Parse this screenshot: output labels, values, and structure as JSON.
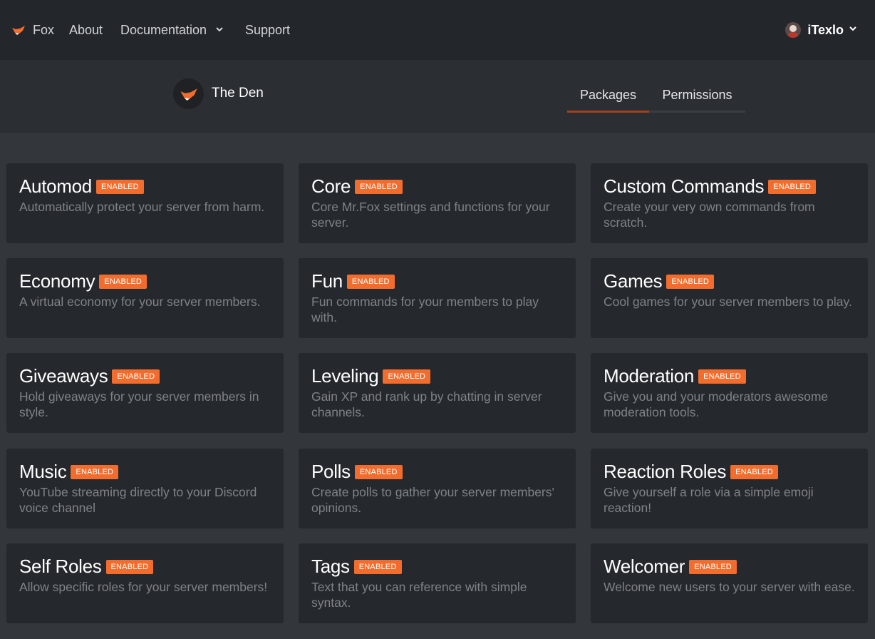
{
  "nav": {
    "brand_label": "Fox",
    "items": [
      "About",
      "Documentation",
      "Support"
    ],
    "user_name": "iTexlo"
  },
  "server": {
    "name": "The Den",
    "tabs": [
      "Packages",
      "Permissions"
    ],
    "active_tab": "Packages"
  },
  "colors": {
    "accent": "#f26d2d",
    "nav_bg": "#23262a",
    "page_bg": "#33363b",
    "card_bg": "#25282c"
  },
  "packages": [
    {
      "title": "Automod",
      "status": "ENABLED",
      "desc": "Automatically protect your server from harm."
    },
    {
      "title": "Core",
      "status": "ENABLED",
      "desc": "Core Mr.Fox settings and functions for your server."
    },
    {
      "title": "Custom Commands",
      "status": "ENABLED",
      "desc": "Create your very own commands from scratch."
    },
    {
      "title": "Economy",
      "status": "ENABLED",
      "desc": "A virtual economy for your server members."
    },
    {
      "title": "Fun",
      "status": "ENABLED",
      "desc": "Fun commands for your members to play with."
    },
    {
      "title": "Games",
      "status": "ENABLED",
      "desc": "Cool games for your server members to play."
    },
    {
      "title": "Giveaways",
      "status": "ENABLED",
      "desc": "Hold giveaways for your server members in style."
    },
    {
      "title": "Leveling",
      "status": "ENABLED",
      "desc": "Gain XP and rank up by chatting in server channels."
    },
    {
      "title": "Moderation",
      "status": "ENABLED",
      "desc": "Give you and your moderators awesome moderation tools."
    },
    {
      "title": "Music",
      "status": "ENABLED",
      "desc": "YouTube streaming directly to your Discord voice channel"
    },
    {
      "title": "Polls",
      "status": "ENABLED",
      "desc": "Create polls to gather your server members' opinions."
    },
    {
      "title": "Reaction Roles",
      "status": "ENABLED",
      "desc": "Give yourself a role via a simple emoji reaction!"
    },
    {
      "title": "Self Roles",
      "status": "ENABLED",
      "desc": "Allow specific roles for your server members!"
    },
    {
      "title": "Tags",
      "status": "ENABLED",
      "desc": "Text that you can reference with simple syntax."
    },
    {
      "title": "Welcomer",
      "status": "ENABLED",
      "desc": "Welcome new users to your server with ease."
    }
  ]
}
